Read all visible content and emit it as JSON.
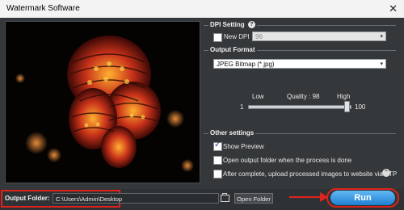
{
  "window": {
    "title": "Watermark Software",
    "close_glyph": "✕"
  },
  "dpi": {
    "section_title": "DPI Setting",
    "help_icon": "?",
    "new_dpi_label": "New DPI",
    "new_dpi_checked": false,
    "dpi_value": "96"
  },
  "format": {
    "section_title": "Output Format",
    "selected": "JPEG Bitmap (*.jpg)",
    "quality_low": "Low",
    "quality_label": "Quality : 98",
    "quality_high": "High",
    "quality_min": "1",
    "quality_max": "100",
    "quality_value": 98
  },
  "other": {
    "section_title": "Other settings",
    "show_preview_label": "Show Preview",
    "show_preview_checked": true,
    "open_output_label": "Open output folder when the process is done",
    "open_output_checked": false,
    "upload_label": "After complete, upload processed images to website via FTP",
    "upload_checked": false
  },
  "bottom": {
    "output_folder_label": "Output Folder:",
    "output_folder_value": "C:\\Users\\Admin\\Desktop",
    "open_folder_label": "Open Folder",
    "run_label": "Run"
  },
  "colors": {
    "highlight_red": "#e0221c",
    "run_blue": "#1f7fd1"
  }
}
